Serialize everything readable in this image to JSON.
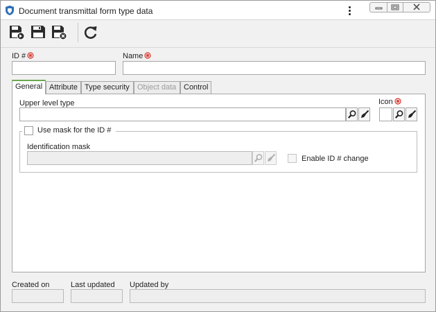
{
  "window": {
    "title": "Document transmittal form type data",
    "app_icon": "app-shield-icon",
    "controls": [
      "minimize-icon",
      "maximize-icon",
      "close-icon"
    ]
  },
  "toolbar": {
    "buttons": [
      {
        "name": "save-and-new-button",
        "icon": "save-new-icon"
      },
      {
        "name": "save-button",
        "icon": "save-icon"
      },
      {
        "name": "save-and-close-button",
        "icon": "save-close-icon"
      },
      {
        "name": "refresh-button",
        "icon": "refresh-icon"
      }
    ]
  },
  "header": {
    "id_label": "ID #",
    "id_value": "",
    "name_label": "Name",
    "name_value": ""
  },
  "tabs": [
    {
      "label": "General",
      "active": true,
      "enabled": true
    },
    {
      "label": "Attribute",
      "active": false,
      "enabled": true
    },
    {
      "label": "Type security",
      "active": false,
      "enabled": true
    },
    {
      "label": "Object data",
      "active": false,
      "enabled": false
    },
    {
      "label": "Control",
      "active": false,
      "enabled": true
    }
  ],
  "general": {
    "upper_level_label": "Upper level type",
    "upper_level_value": "",
    "icon_label": "Icon",
    "use_mask_label": "Use mask for the ID #",
    "use_mask_checked": false,
    "identification_mask_label": "Identification mask",
    "identification_mask_value": "",
    "enable_id_change_label": "Enable ID # change",
    "enable_id_change_checked": false
  },
  "footer": {
    "created_on_label": "Created on",
    "created_on_value": "",
    "last_updated_label": "Last updated",
    "last_updated_value": "",
    "updated_by_label": "Updated by",
    "updated_by_value": ""
  },
  "colors": {
    "required_marker": "#d9342b",
    "active_tab_accent": "#6aa84f",
    "app_icon_blue": "#2f6fb5"
  }
}
